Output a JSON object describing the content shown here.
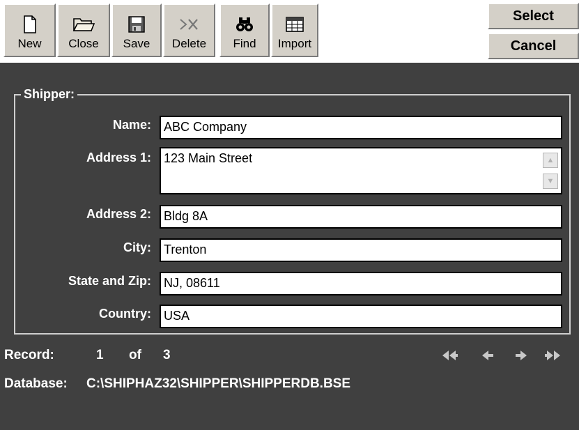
{
  "toolbar": {
    "buttons": [
      {
        "label": "New",
        "icon": "new-document-icon"
      },
      {
        "label": "Close",
        "icon": "folder-icon"
      },
      {
        "label": "Save",
        "icon": "floppy-disk-icon"
      },
      {
        "label": "Delete",
        "icon": "delete-icon"
      },
      {
        "label": "Find",
        "icon": "binoculars-icon"
      },
      {
        "label": "Import",
        "icon": "table-grid-icon"
      }
    ],
    "select_label": "Select",
    "cancel_label": "Cancel"
  },
  "shipper": {
    "group_title": "Shipper:",
    "fields": {
      "name": {
        "label": "Name:",
        "value": "ABC Company"
      },
      "address1": {
        "label": "Address 1:",
        "value": "123 Main Street"
      },
      "address2": {
        "label": "Address 2:",
        "value": "Bldg 8A"
      },
      "city": {
        "label": "City:",
        "value": "Trenton"
      },
      "state_zip": {
        "label": "State and Zip:",
        "value": "NJ, 08611"
      },
      "country": {
        "label": "Country:",
        "value": "USA"
      }
    }
  },
  "record": {
    "label": "Record:",
    "current": "1",
    "of_label": "of",
    "total": "3"
  },
  "navigation": {
    "icons": [
      "first-record-icon",
      "previous-record-icon",
      "next-record-icon",
      "last-record-icon"
    ]
  },
  "database": {
    "label": "Database:",
    "path": "C:\\SHIPHAZ32\\SHIPPER\\SHIPPERDB.BSE"
  },
  "colors": {
    "background": "#404040",
    "button_face": "#d4d0c8",
    "text": "#ffffff"
  }
}
